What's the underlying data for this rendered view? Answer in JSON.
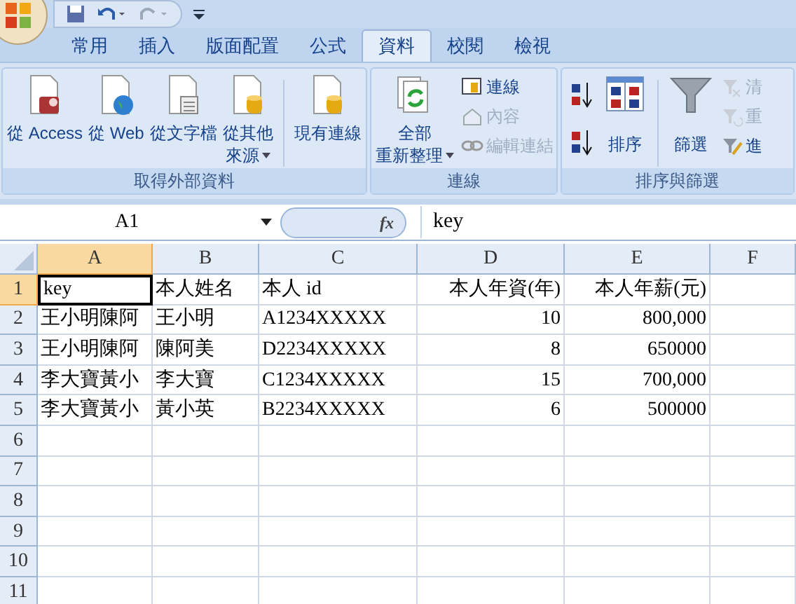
{
  "tabs": [
    {
      "label": "常用",
      "selected": false
    },
    {
      "label": "插入",
      "selected": false
    },
    {
      "label": "版面配置",
      "selected": false
    },
    {
      "label": "公式",
      "selected": false
    },
    {
      "label": "資料",
      "selected": true
    },
    {
      "label": "校閱",
      "selected": false
    },
    {
      "label": "檢視",
      "selected": false
    }
  ],
  "ribbon_groups": [
    {
      "label": "取得外部資料",
      "controls": [
        {
          "kind": "large",
          "lines": [
            "從 Access"
          ]
        },
        {
          "kind": "large",
          "lines": [
            "從 Web"
          ]
        },
        {
          "kind": "large",
          "lines": [
            "從文字檔"
          ]
        },
        {
          "kind": "large",
          "lines": [
            "從其他",
            "來源"
          ],
          "menu": true
        },
        {
          "kind": "separator"
        },
        {
          "kind": "large",
          "lines": [
            "現有連線"
          ]
        }
      ]
    },
    {
      "label": "連線",
      "controls": [
        {
          "kind": "large",
          "lines": [
            "全部",
            "重新整理"
          ],
          "menu": true
        },
        {
          "kind": "stack",
          "items": [
            {
              "label": "連線",
              "disabled": false
            },
            {
              "label": "內容",
              "disabled": true
            },
            {
              "label": "編輯連結",
              "disabled": true
            }
          ]
        }
      ]
    },
    {
      "label": "排序與篩選",
      "controls": [
        {
          "kind": "sortpair"
        },
        {
          "kind": "large",
          "lines": [
            "排序"
          ]
        },
        {
          "kind": "separator"
        },
        {
          "kind": "large",
          "lines": [
            "篩選"
          ]
        },
        {
          "kind": "stack",
          "items": [
            {
              "label": "清",
              "disabled": true
            },
            {
              "label": "重",
              "disabled": true
            },
            {
              "label": "進",
              "disabled": false
            }
          ]
        }
      ]
    }
  ],
  "name_box": "A1",
  "function_button": "fx",
  "formula": "key",
  "columns": [
    {
      "label": "A",
      "selected": true
    },
    {
      "label": "B",
      "selected": false
    },
    {
      "label": "C",
      "selected": false
    },
    {
      "label": "D",
      "selected": false
    },
    {
      "label": "E",
      "selected": false
    },
    {
      "label": "F",
      "selected": false
    }
  ],
  "rows": [
    {
      "label": "1",
      "selected": true,
      "cells": [
        "key",
        "本人姓名",
        "本人 id",
        "本人年資(年)",
        "本人年薪(元)",
        ""
      ]
    },
    {
      "label": "2",
      "selected": false,
      "cells": [
        "王小明陳阿",
        "王小明",
        "A1234XXXXX",
        "10",
        "800,000",
        ""
      ]
    },
    {
      "label": "3",
      "selected": false,
      "cells": [
        "王小明陳阿",
        "陳阿美",
        "D2234XXXXX",
        "8",
        "650000",
        ""
      ]
    },
    {
      "label": "4",
      "selected": false,
      "cells": [
        "李大寶黃小",
        "李大寶",
        "C1234XXXXX",
        "15",
        "700,000",
        ""
      ]
    },
    {
      "label": "5",
      "selected": false,
      "cells": [
        "李大寶黃小",
        "黃小英",
        "B2234XXXXX",
        "6",
        "500000",
        ""
      ]
    },
    {
      "label": "6",
      "selected": false,
      "cells": [
        "",
        "",
        "",
        "",
        "",
        ""
      ]
    },
    {
      "label": "7",
      "selected": false,
      "cells": [
        "",
        "",
        "",
        "",
        "",
        ""
      ]
    },
    {
      "label": "8",
      "selected": false,
      "cells": [
        "",
        "",
        "",
        "",
        "",
        ""
      ]
    },
    {
      "label": "9",
      "selected": false,
      "cells": [
        "",
        "",
        "",
        "",
        "",
        ""
      ]
    },
    {
      "label": "10",
      "selected": false,
      "cells": [
        "",
        "",
        "",
        "",
        "",
        ""
      ]
    },
    {
      "label": "11",
      "selected": false,
      "cells": [
        "",
        "",
        "",
        "",
        "",
        ""
      ]
    }
  ]
}
